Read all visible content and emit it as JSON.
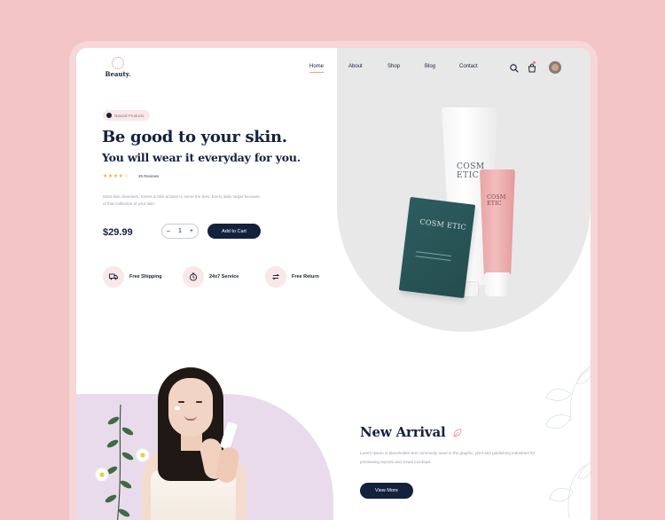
{
  "brand": {
    "name": "Beauty."
  },
  "nav": {
    "items": [
      {
        "label": "Home",
        "active": true
      },
      {
        "label": "About",
        "active": false
      },
      {
        "label": "Shop",
        "active": false
      },
      {
        "label": "Blog",
        "active": false
      },
      {
        "label": "Contact",
        "active": false
      }
    ]
  },
  "header_icons": [
    "search-icon",
    "cart-icon",
    "avatar"
  ],
  "hero": {
    "badge": "Natural Products",
    "title_line1": "Be good to your skin.",
    "title_line2": "You will wear it everyday for you.",
    "rating": 4.5,
    "stars": "★★★★☆",
    "reviews": "25 Reviews",
    "description": "Most skin cleansers, toners & skin actives to serve the best. Every daily target because of that collection of your skin.",
    "price": "$29.99",
    "quantity": "1",
    "decrement_label": "–",
    "increment_label": "+",
    "add_to_cart": "Add to Cart"
  },
  "features": [
    {
      "label": "Free Shipping",
      "icon": "truck-icon"
    },
    {
      "label": "24x7 Service",
      "icon": "clock-icon"
    },
    {
      "label": "Free Return",
      "icon": "return-icon"
    }
  ],
  "products": {
    "tube_label": "COSM ETIC",
    "pink_tube_label": "COSM ETIC",
    "sachet_label": "COSM ETIC"
  },
  "new_arrival": {
    "title": "New Arrival",
    "description": "Lorem Ipsum is placeholder text commonly used in the graphic, print and publishing industries for previewing layouts and visual mockups.",
    "button": "View More"
  },
  "colors": {
    "background": "#f2c4c6",
    "navy": "#14213d",
    "pink_soft": "#fbe7e8",
    "hero_gray": "#e8e8e9",
    "lavender": "#e9dbec",
    "star": "#f2b03c"
  }
}
